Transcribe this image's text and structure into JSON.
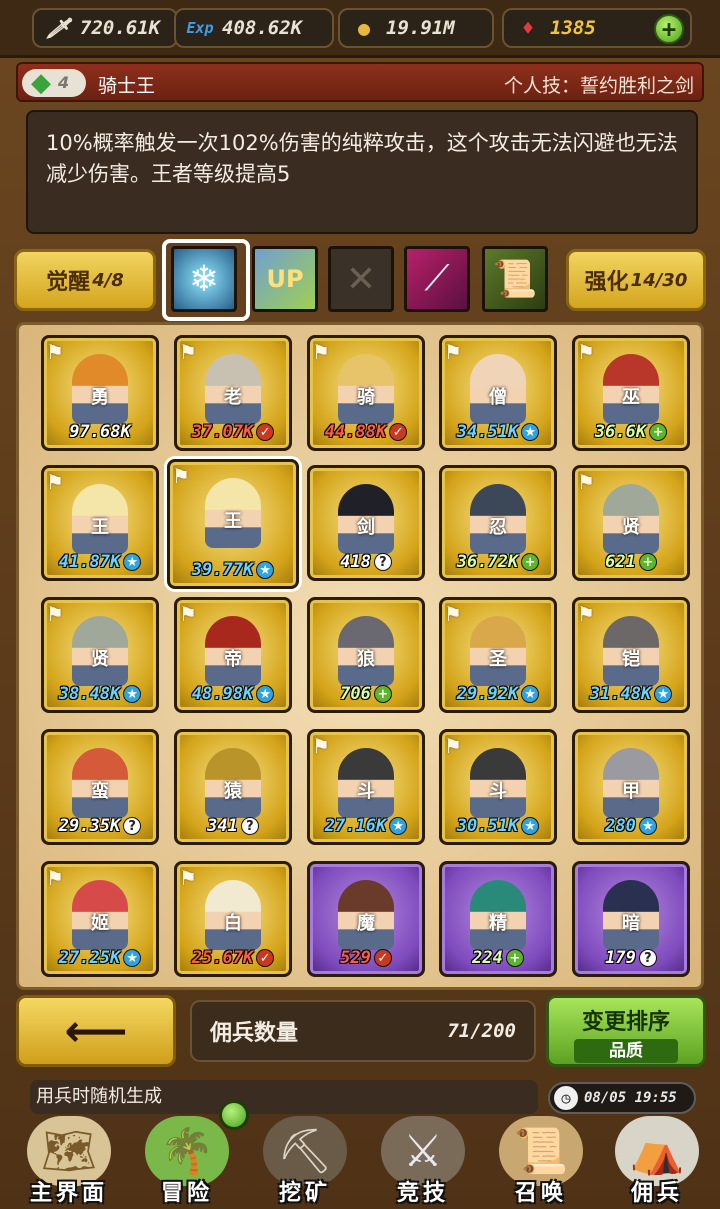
{
  "resources": {
    "attack": "720.61K",
    "exp": "408.62K",
    "gold": "19.91M",
    "gems": "1385",
    "attack_icon": "sword-icon",
    "exp_icon": "exp-icon",
    "gold_icon": "gold-coin-icon",
    "gem_icon": "ruby-icon"
  },
  "skill": {
    "level": "4",
    "name": "骑士王",
    "personal_label": "个人技：誓约胜利之剑",
    "description": "10%概率触发一次102%伤害的纯粹攻击，这个攻击无法闪避也无法减少伤害。王者等级提高5"
  },
  "awaken": {
    "label": "觉醒",
    "value": "4/8"
  },
  "enhance": {
    "label": "强化",
    "value": "14/30"
  },
  "skill_icons": [
    "ice-axe-icon",
    "up-buff-icon",
    "locked-slot-icon",
    "crystal-sword-icon",
    "scroll-icon"
  ],
  "mercenaries": [
    {
      "power": "97.68K",
      "badge": "none",
      "color": "#e08a2a",
      "face": "勇"
    },
    {
      "power": "37.07K",
      "badge": "red",
      "color": "#c8c0b0",
      "face": "老"
    },
    {
      "power": "44.88K",
      "badge": "red",
      "color": "#e7c36a",
      "face": "骑"
    },
    {
      "power": "34.51K",
      "badge": "star",
      "color": "#f0d4b8",
      "face": "僧"
    },
    {
      "power": "36.6K",
      "badge": "plus",
      "color": "#b8362a",
      "face": "巫"
    },
    {
      "power": "41.87K",
      "badge": "star",
      "color": "#f3e6a8",
      "face": "王"
    },
    {
      "power": "39.77K",
      "badge": "star",
      "color": "#f3e6a8",
      "face": "王"
    },
    {
      "power": "418",
      "badge": "q",
      "color": "#202028",
      "face": "剑"
    },
    {
      "power": "36.72K",
      "badge": "plus",
      "color": "#3c4858",
      "face": "忍"
    },
    {
      "power": "621",
      "badge": "plus",
      "color": "#a0a89a",
      "face": "贤"
    },
    {
      "power": "38.48K",
      "badge": "star",
      "color": "#a0a89a",
      "face": "贤"
    },
    {
      "power": "48.98K",
      "badge": "star",
      "color": "#a8281e",
      "face": "帝"
    },
    {
      "power": "706",
      "badge": "plus",
      "color": "#6a6870",
      "face": "狼"
    },
    {
      "power": "29.92K",
      "badge": "star",
      "color": "#d9a84a",
      "face": "圣"
    },
    {
      "power": "31.48K",
      "badge": "star",
      "color": "#6c6868",
      "face": "铠"
    },
    {
      "power": "29.35K",
      "badge": "q",
      "color": "#d45a3a",
      "face": "蛮"
    },
    {
      "power": "341",
      "badge": "q",
      "color": "#b8942a",
      "face": "猿"
    },
    {
      "power": "27.16K",
      "badge": "star",
      "color": "#3a3a3a",
      "face": "斗"
    },
    {
      "power": "30.51K",
      "badge": "star",
      "color": "#3a3a3a",
      "face": "斗"
    },
    {
      "power": "280",
      "badge": "star",
      "color": "#9a9aa0",
      "face": "甲"
    },
    {
      "power": "27.25K",
      "badge": "star",
      "color": "#d64a4a",
      "face": "姬"
    },
    {
      "power": "25.67K",
      "badge": "red",
      "color": "#f2ead0",
      "face": "白"
    },
    {
      "power": "529",
      "badge": "red",
      "color": "#6a3a2a",
      "face": "魔"
    },
    {
      "power": "224",
      "badge": "plus",
      "color": "#2a8a7a",
      "face": "精"
    },
    {
      "power": "179",
      "badge": "q",
      "color": "#2a3050",
      "face": "暗"
    }
  ],
  "footer": {
    "count_label": "佣兵数量",
    "count_value": "71/200",
    "sort_label": "变更排序",
    "sort_mode": "品质",
    "ticker": "用兵时随机生成",
    "datetime": "08/05 19:55"
  },
  "nav": [
    {
      "label": "主界面",
      "icon": "map-scroll-icon"
    },
    {
      "label": "冒险",
      "icon": "island-icon"
    },
    {
      "label": "挖矿",
      "icon": "pickaxe-icon"
    },
    {
      "label": "竞技",
      "icon": "crossed-swords-icon"
    },
    {
      "label": "召唤",
      "icon": "summon-scroll-icon"
    },
    {
      "label": "佣兵",
      "icon": "tent-icon"
    }
  ]
}
